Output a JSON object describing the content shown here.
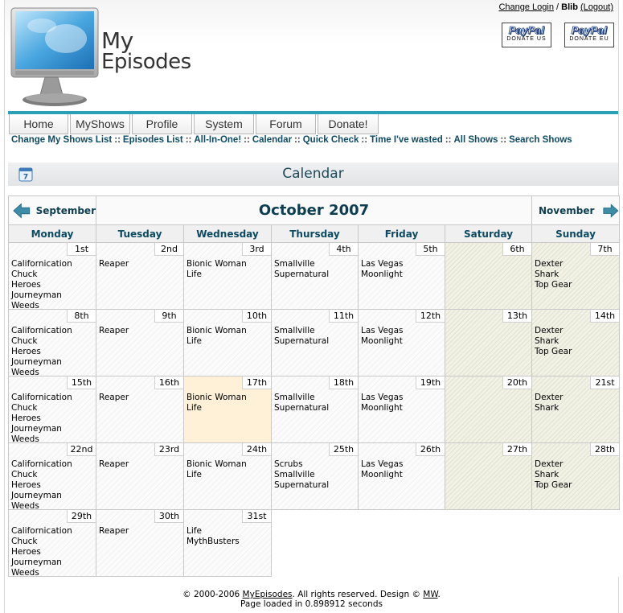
{
  "header": {
    "logo_my": "My",
    "logo_episodes": "Episodes",
    "change_login": "Change Login",
    "username": "Blib",
    "logout": "(Logout)",
    "donate_us": {
      "brand": "PayPal",
      "label": "DONATE US"
    },
    "donate_eu": {
      "brand": "PayPal",
      "label": "DONATE EU"
    }
  },
  "nav": {
    "tabs": [
      "Home",
      "MyShows",
      "Profile",
      "System",
      "Forum",
      "Donate!"
    ],
    "sublinks": [
      "Change My Shows List",
      "Episodes List",
      "All-In-One!",
      "Calendar",
      "Quick Check",
      "Time I've wasted",
      "All Shows",
      "Search Shows"
    ],
    "separator": "::"
  },
  "page": {
    "title": "Calendar"
  },
  "calendar": {
    "prev_month": "September",
    "current_month": "October 2007",
    "next_month": "November",
    "days": [
      "Monday",
      "Tuesday",
      "Wednesday",
      "Thursday",
      "Friday",
      "Saturday",
      "Sunday"
    ],
    "weeks": [
      [
        {
          "date": "1st",
          "shows": [
            "Californication",
            "Chuck",
            "Heroes",
            "Journeyman",
            "Weeds"
          ]
        },
        {
          "date": "2nd",
          "shows": [
            "Reaper"
          ]
        },
        {
          "date": "3rd",
          "shows": [
            "Bionic Woman",
            "Life"
          ]
        },
        {
          "date": "4th",
          "shows": [
            "Smallville",
            "Supernatural"
          ]
        },
        {
          "date": "5th",
          "shows": [
            "Las Vegas",
            "Moonlight"
          ]
        },
        {
          "date": "6th",
          "shows": []
        },
        {
          "date": "7th",
          "shows": [
            "Dexter",
            "Shark",
            "Top Gear"
          ]
        }
      ],
      [
        {
          "date": "8th",
          "shows": [
            "Californication",
            "Chuck",
            "Heroes",
            "Journeyman",
            "Weeds"
          ]
        },
        {
          "date": "9th",
          "shows": [
            "Reaper"
          ]
        },
        {
          "date": "10th",
          "shows": [
            "Bionic Woman",
            "Life"
          ]
        },
        {
          "date": "11th",
          "shows": [
            "Smallville",
            "Supernatural"
          ]
        },
        {
          "date": "12th",
          "shows": [
            "Las Vegas",
            "Moonlight"
          ]
        },
        {
          "date": "13th",
          "shows": []
        },
        {
          "date": "14th",
          "shows": [
            "Dexter",
            "Shark",
            "Top Gear"
          ]
        }
      ],
      [
        {
          "date": "15th",
          "shows": [
            "Californication",
            "Chuck",
            "Heroes",
            "Journeyman",
            "Weeds"
          ]
        },
        {
          "date": "16th",
          "shows": [
            "Reaper"
          ]
        },
        {
          "date": "17th",
          "shows": [
            "Bionic Woman",
            "Life"
          ],
          "today": true
        },
        {
          "date": "18th",
          "shows": [
            "Smallville",
            "Supernatural"
          ]
        },
        {
          "date": "19th",
          "shows": [
            "Las Vegas",
            "Moonlight"
          ]
        },
        {
          "date": "20th",
          "shows": []
        },
        {
          "date": "21st",
          "shows": [
            "Dexter",
            "Shark"
          ]
        }
      ],
      [
        {
          "date": "22nd",
          "shows": [
            "Californication",
            "Chuck",
            "Heroes",
            "Journeyman",
            "Weeds"
          ]
        },
        {
          "date": "23rd",
          "shows": [
            "Reaper"
          ]
        },
        {
          "date": "24th",
          "shows": [
            "Bionic Woman",
            "Life"
          ]
        },
        {
          "date": "25th",
          "shows": [
            "Scrubs",
            "Smallville",
            "Supernatural"
          ]
        },
        {
          "date": "26th",
          "shows": [
            "Las Vegas",
            "Moonlight"
          ]
        },
        {
          "date": "27th",
          "shows": []
        },
        {
          "date": "28th",
          "shows": [
            "Dexter",
            "Shark",
            "Top Gear"
          ]
        }
      ],
      [
        {
          "date": "29th",
          "shows": [
            "Californication",
            "Chuck",
            "Heroes",
            "Journeyman",
            "Weeds"
          ]
        },
        {
          "date": "30th",
          "shows": [
            "Reaper"
          ]
        },
        {
          "date": "31st",
          "shows": [
            "Life",
            "MythBusters"
          ]
        },
        null,
        null,
        null,
        null
      ]
    ]
  },
  "footer": {
    "copyright_prefix": "© 2000-2006 ",
    "site_link": "MyEpisodes",
    "rights": ". All rights reserved. Design © ",
    "designer_link": "MW",
    "period": ".",
    "load_time": "Page loaded in 0.898912 seconds"
  },
  "colors": {
    "accent_teal": "#2aa0b6",
    "link_dark": "#0c4b63",
    "weekend_bg": "#f2f1e6",
    "today_bg": "#fff0d8"
  }
}
